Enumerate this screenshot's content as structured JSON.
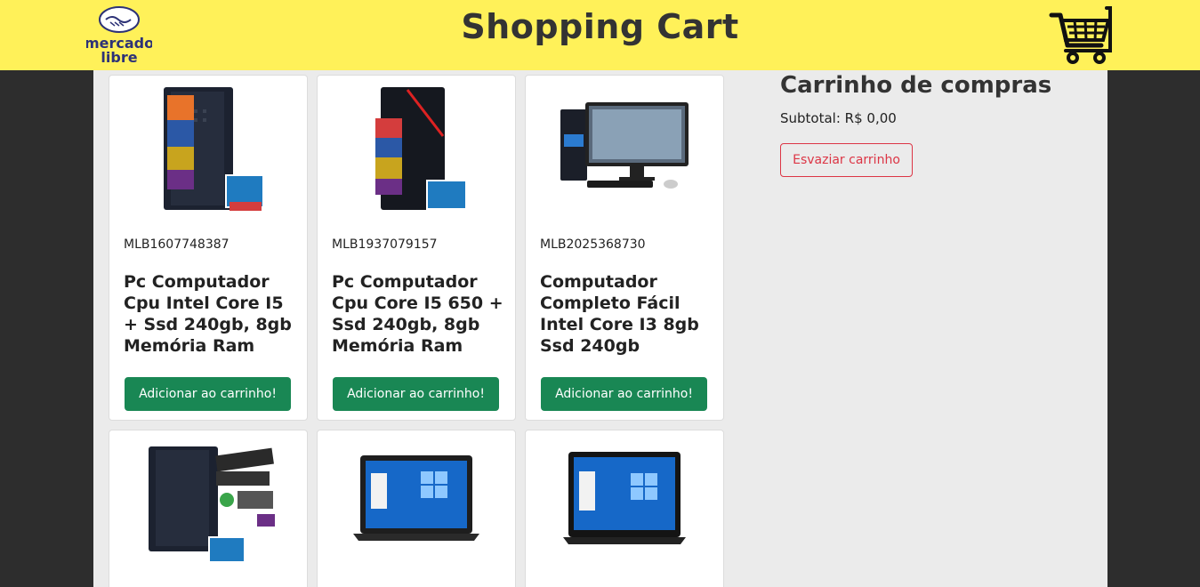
{
  "header": {
    "logo_text_line1": "mercado",
    "logo_text_line2": "libre",
    "title": "Shopping Cart"
  },
  "products": [
    {
      "id": "MLB1607748387",
      "title": "Pc Computador Cpu Intel Core I5 + Ssd 240gb, 8gb Memória Ram",
      "button": "Adicionar ao carrinho!",
      "image": "desktop-tower"
    },
    {
      "id": "MLB1937079157",
      "title": "Pc Computador Cpu Core I5 650 + Ssd 240gb, 8gb Memória Ram",
      "button": "Adicionar ao carrinho!",
      "image": "desktop-tower-red"
    },
    {
      "id": "MLB2025368730",
      "title": "Computador Completo Fácil Intel Core I3 8gb Ssd 240gb",
      "button": "Adicionar ao carrinho!",
      "image": "desktop-monitor-kit"
    },
    {
      "id": "",
      "title": "",
      "button": "",
      "image": "desktop-tower"
    },
    {
      "id": "",
      "title": "",
      "button": "",
      "image": "laptop"
    },
    {
      "id": "",
      "title": "",
      "button": "",
      "image": "laptop"
    }
  ],
  "cart": {
    "heading": "Carrinho de compras",
    "subtotal": "Subtotal: R$ 0,00",
    "empty_button": "Esvaziar carrinho"
  },
  "colors": {
    "header_bg": "#fff159",
    "add_button": "#198754",
    "empty_button": "#dc3545"
  }
}
